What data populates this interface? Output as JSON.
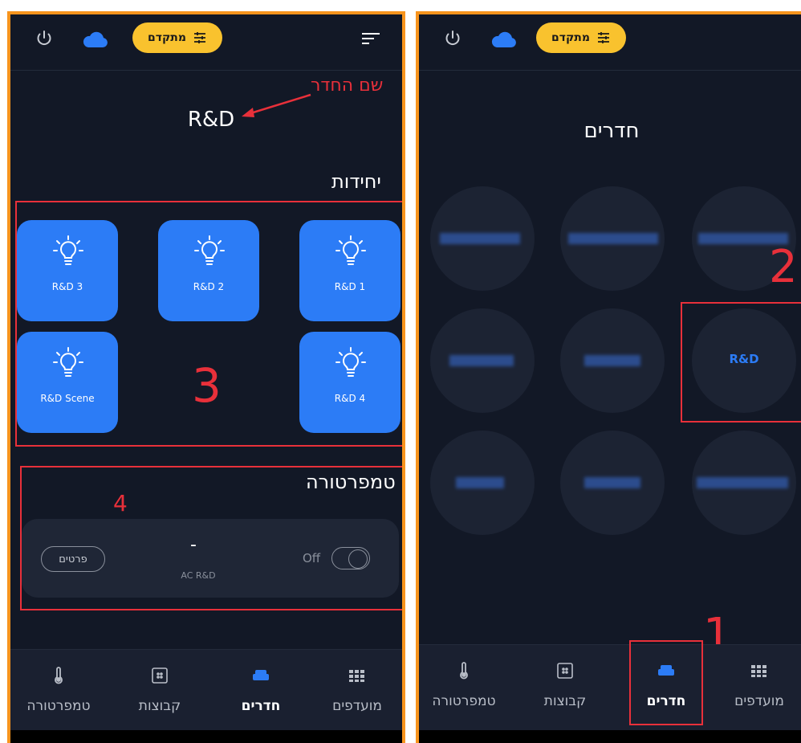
{
  "left_screen": {
    "header": {
      "power_icon": "power-icon",
      "cloud_icon": "cloud-icon",
      "advanced_label": "מתקדם",
      "menu_icon": "sort-menu-icon"
    },
    "room_label_annotation": "שם החדר",
    "room_name": "R&D",
    "units_title": "יחידות",
    "units": [
      {
        "label": "R&D 1"
      },
      {
        "label": "R&D 2"
      },
      {
        "label": "R&D 3"
      },
      {
        "label": "R&D 4"
      },
      {
        "label": "R&D Scene"
      }
    ],
    "annotation_3": "3",
    "temperature_title": "טמפרטורה",
    "annotation_4": "4",
    "ac": {
      "value": "-",
      "name": "AC R&D",
      "state_label": "Off",
      "details_label": "פרטים",
      "on": false
    }
  },
  "right_screen": {
    "header": {
      "advanced_label": "מתקדם"
    },
    "page_title": "חדרים",
    "highlighted_room": "R&D",
    "annotation_1": "1",
    "annotation_2": "2"
  },
  "nav": {
    "favorites": "מועדפים",
    "rooms": "חדרים",
    "groups": "קבוצות",
    "temperature": "טמפרטורה"
  },
  "colors": {
    "background": "#121826",
    "tile": "#2c7cf6",
    "accent_yellow": "#f9c22e",
    "annotation_red": "#e8303a",
    "annotation_orange": "#f7941d"
  }
}
